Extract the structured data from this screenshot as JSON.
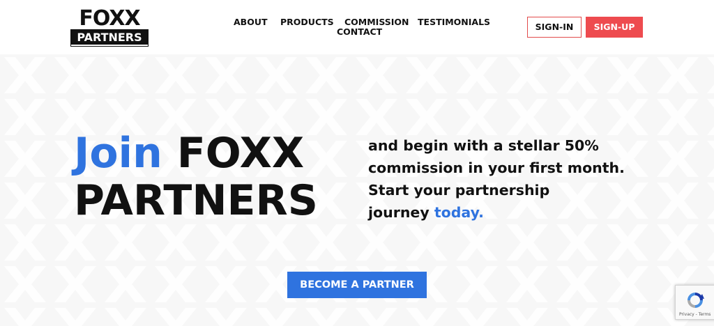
{
  "brand": {
    "logo_top": "FOXX",
    "logo_bottom": "PARTNERS"
  },
  "nav": {
    "about": "ABOUT",
    "products": "PRODUCTS",
    "commission": "COMMISSION",
    "testimonials": "TESTIMONIALS",
    "contact": "CONTACT"
  },
  "auth": {
    "signin_label": "SIGN-IN",
    "signup_label": "SIGN-UP"
  },
  "hero": {
    "headline_highlight": "Join",
    "headline_rest_1": "FOXX",
    "headline_rest_2": "PARTNERS",
    "sub_line_1": "and begin with a stellar 50%",
    "sub_line_2": "commission in your first month.",
    "sub_line_3": "Start your partnership",
    "sub_line_4_prefix": "journey",
    "sub_line_4_highlight": "today.",
    "cta_label": "BECOME A PARTNER"
  },
  "recaptcha": {
    "icon": "recaptcha-icon",
    "terms": "Privacy - Terms"
  },
  "colors": {
    "accent_blue": "#2f73df",
    "accent_red": "#ee4b4f",
    "text_dark": "#111111",
    "hero_bg": "#f7f7f7"
  }
}
